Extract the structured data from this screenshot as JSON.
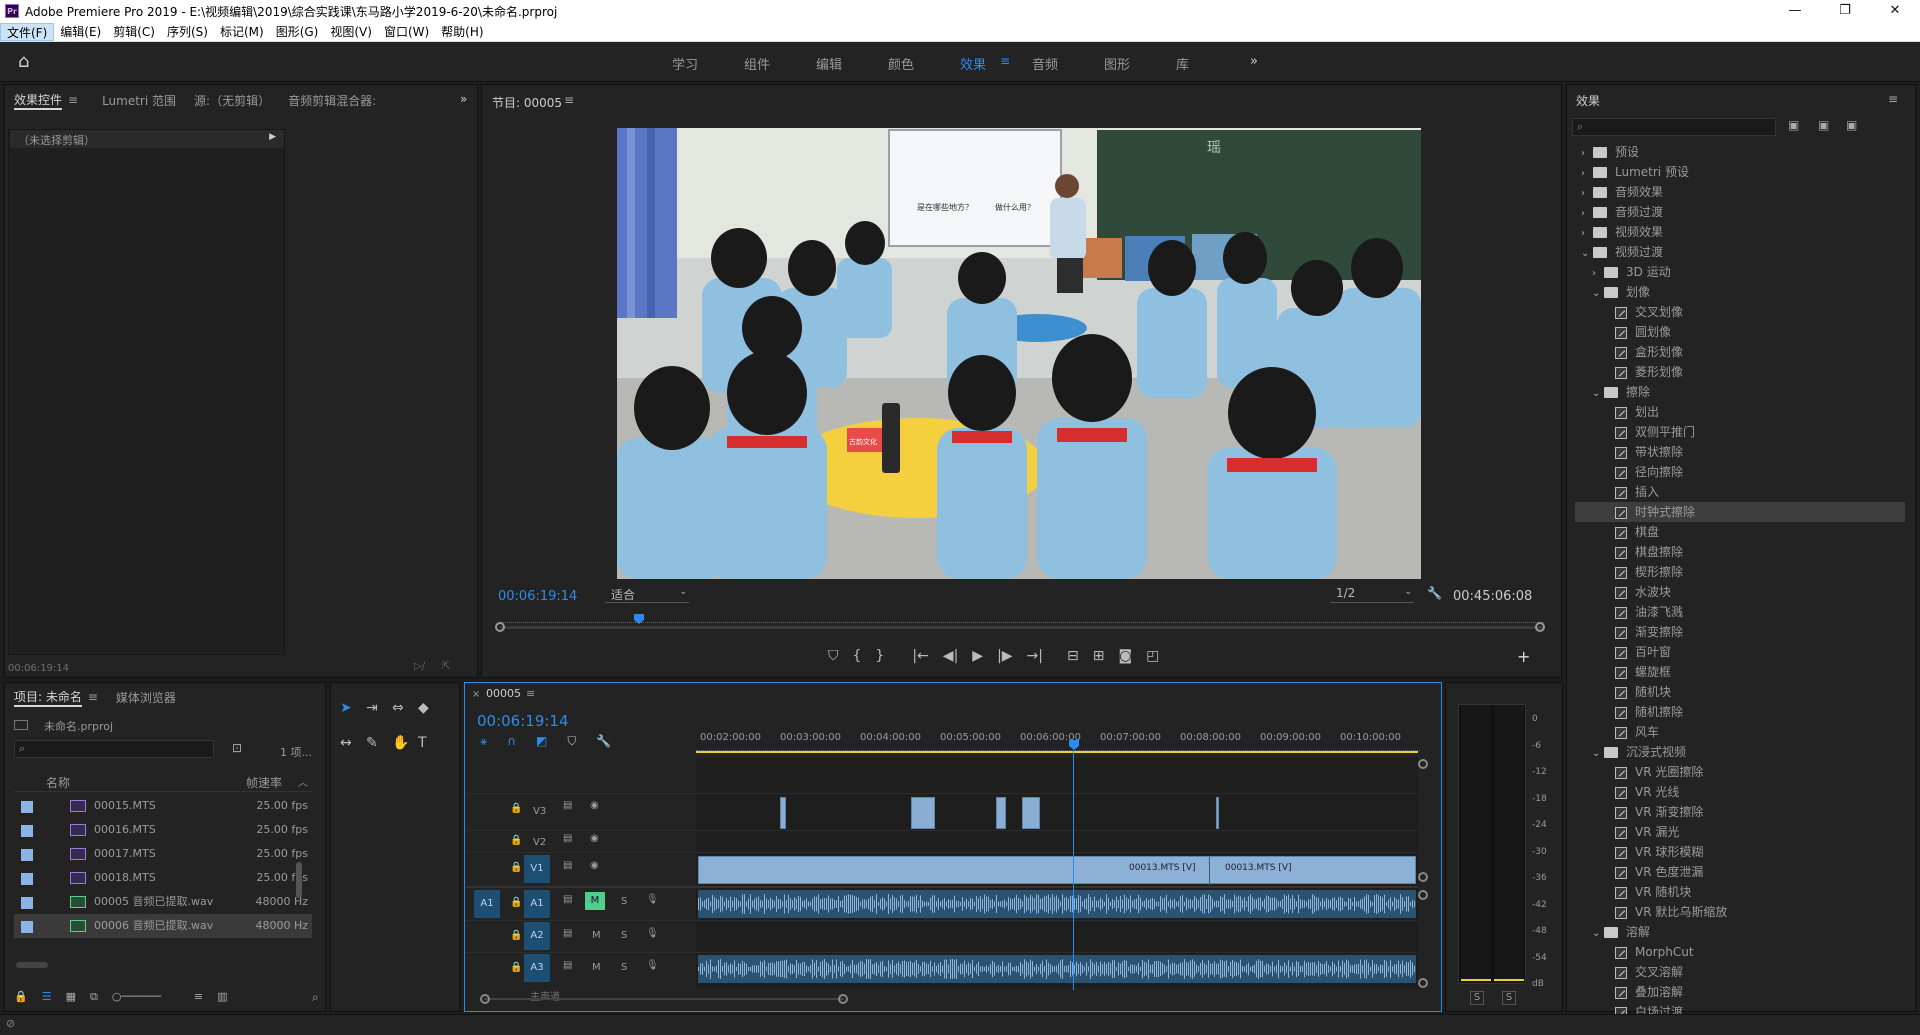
{
  "app": {
    "title": "Adobe Premiere Pro 2019 - E:\\视频编辑\\2019\\综合实践课\\东马路小学2019-6-20\\未命名.prproj",
    "icon_letters": "Pr"
  },
  "menu": [
    "文件(F)",
    "编辑(E)",
    "剪辑(C)",
    "序列(S)",
    "标记(M)",
    "图形(G)",
    "视图(V)",
    "窗口(W)",
    "帮助(H)"
  ],
  "workspaces": [
    "学习",
    "组件",
    "编辑",
    "颜色",
    "效果",
    "音频",
    "图形",
    "库"
  ],
  "workspace_active": "效果",
  "source_panel": {
    "tabs": [
      "效果控件",
      "Lumetri 范围",
      "源:（无剪辑）",
      "音频剪辑混合器:"
    ],
    "no_clip": "（未选择剪辑）",
    "timecode": "00:06:19:14"
  },
  "program_monitor": {
    "title": "节目: 00005",
    "timecode_left": "00:06:19:14",
    "fit_select": "适合",
    "resolution_select": "1/2",
    "timecode_right": "00:45:06:08",
    "projection_words": [
      "是在哪些地方？",
      "做什么用？"
    ],
    "blackboard_char": "瑶",
    "desk_label": "古韵文化"
  },
  "project_panel": {
    "tabs": [
      "项目: 未命名",
      "媒体浏览器"
    ],
    "file": "未命名.prproj",
    "count": "1 项...",
    "columns": {
      "name": "名称",
      "rate": "帧速率"
    },
    "items": [
      {
        "name": "00015.MTS",
        "rate": "25.00 fps",
        "type": "video"
      },
      {
        "name": "00016.MTS",
        "rate": "25.00 fps",
        "type": "video"
      },
      {
        "name": "00017.MTS",
        "rate": "25.00 fps",
        "type": "video"
      },
      {
        "name": "00018.MTS",
        "rate": "25.00 fps",
        "type": "video"
      },
      {
        "name": "00005 音频已提取.wav",
        "rate": "48000 Hz",
        "type": "audio"
      },
      {
        "name": "00006 音频已提取.wav",
        "rate": "48000 Hz",
        "type": "audio"
      }
    ]
  },
  "timeline": {
    "tab": "00005",
    "timecode": "00:06:19:14",
    "ruler": [
      "00:02:00:00",
      "00:03:00:00",
      "00:04:00:00",
      "00:05:00:00",
      "00:06:00:00",
      "00:07:00:00",
      "00:08:00:00",
      "00:09:00:00",
      "00:10:00:00"
    ],
    "tracks": {
      "v3": "V3",
      "v2": "V2",
      "v1": "V1",
      "a1_src": "A1",
      "a1": "A1",
      "a2": "A2",
      "a3": "A3",
      "m": "M",
      "s": "S",
      "master": "主声道"
    },
    "clip_labels": [
      "00013.MTS [V]",
      "00013.MTS [V]"
    ]
  },
  "audio_meter": {
    "scale": [
      "0",
      "-6",
      "-12",
      "-18",
      "-24",
      "-30",
      "-36",
      "-42",
      "-48",
      "-54",
      "dB"
    ],
    "solo": "S"
  },
  "effects_panel": {
    "title": "效果",
    "tree": [
      {
        "level": 0,
        "type": "folder",
        "arrow": "›",
        "label": "预设",
        "special": true
      },
      {
        "level": 0,
        "type": "folder",
        "arrow": "›",
        "label": "Lumetri 预设",
        "special": true
      },
      {
        "level": 0,
        "type": "folder",
        "arrow": "›",
        "label": "音频效果"
      },
      {
        "level": 0,
        "type": "folder",
        "arrow": "›",
        "label": "音频过渡"
      },
      {
        "level": 0,
        "type": "folder",
        "arrow": "›",
        "label": "视频效果"
      },
      {
        "level": 0,
        "type": "folder",
        "arrow": "⌄",
        "label": "视频过渡"
      },
      {
        "level": 1,
        "type": "folder",
        "arrow": "›",
        "label": "3D 运动"
      },
      {
        "level": 1,
        "type": "folder",
        "arrow": "⌄",
        "label": "划像"
      },
      {
        "level": 2,
        "type": "fx",
        "label": "交叉划像"
      },
      {
        "level": 2,
        "type": "fx",
        "label": "圆划像"
      },
      {
        "level": 2,
        "type": "fx",
        "label": "盒形划像"
      },
      {
        "level": 2,
        "type": "fx",
        "label": "菱形划像"
      },
      {
        "level": 1,
        "type": "folder",
        "arrow": "⌄",
        "label": "擦除"
      },
      {
        "level": 2,
        "type": "fx",
        "label": "划出"
      },
      {
        "level": 2,
        "type": "fx",
        "label": "双侧平推门"
      },
      {
        "level": 2,
        "type": "fx",
        "label": "带状擦除"
      },
      {
        "level": 2,
        "type": "fx",
        "label": "径向擦除"
      },
      {
        "level": 2,
        "type": "fx",
        "label": "插入"
      },
      {
        "level": 2,
        "type": "fx",
        "label": "时钟式擦除",
        "selected": true
      },
      {
        "level": 2,
        "type": "fx",
        "label": "棋盘"
      },
      {
        "level": 2,
        "type": "fx",
        "label": "棋盘擦除"
      },
      {
        "level": 2,
        "type": "fx",
        "label": "楔形擦除"
      },
      {
        "level": 2,
        "type": "fx",
        "label": "水波块"
      },
      {
        "level": 2,
        "type": "fx",
        "label": "油漆飞溅"
      },
      {
        "level": 2,
        "type": "fx",
        "label": "渐变擦除"
      },
      {
        "level": 2,
        "type": "fx",
        "label": "百叶窗"
      },
      {
        "level": 2,
        "type": "fx",
        "label": "螺旋框"
      },
      {
        "level": 2,
        "type": "fx",
        "label": "随机块"
      },
      {
        "level": 2,
        "type": "fx",
        "label": "随机擦除"
      },
      {
        "level": 2,
        "type": "fx",
        "label": "风车"
      },
      {
        "level": 1,
        "type": "folder",
        "arrow": "⌄",
        "label": "沉浸式视频"
      },
      {
        "level": 2,
        "type": "fx",
        "label": "VR 光圈擦除"
      },
      {
        "level": 2,
        "type": "fx",
        "label": "VR 光线"
      },
      {
        "level": 2,
        "type": "fx",
        "label": "VR 渐变擦除"
      },
      {
        "level": 2,
        "type": "fx",
        "label": "VR 漏光"
      },
      {
        "level": 2,
        "type": "fx",
        "label": "VR 球形模糊"
      },
      {
        "level": 2,
        "type": "fx",
        "label": "VR 色度泄漏"
      },
      {
        "level": 2,
        "type": "fx",
        "label": "VR 随机块"
      },
      {
        "level": 2,
        "type": "fx",
        "label": "VR 默比乌斯缩放"
      },
      {
        "level": 1,
        "type": "folder",
        "arrow": "⌄",
        "label": "溶解"
      },
      {
        "level": 2,
        "type": "fx",
        "label": "MorphCut"
      },
      {
        "level": 2,
        "type": "fx",
        "label": "交叉溶解"
      },
      {
        "level": 2,
        "type": "fx",
        "label": "叠加溶解"
      },
      {
        "level": 2,
        "type": "fx",
        "label": "白场过渡"
      }
    ]
  }
}
